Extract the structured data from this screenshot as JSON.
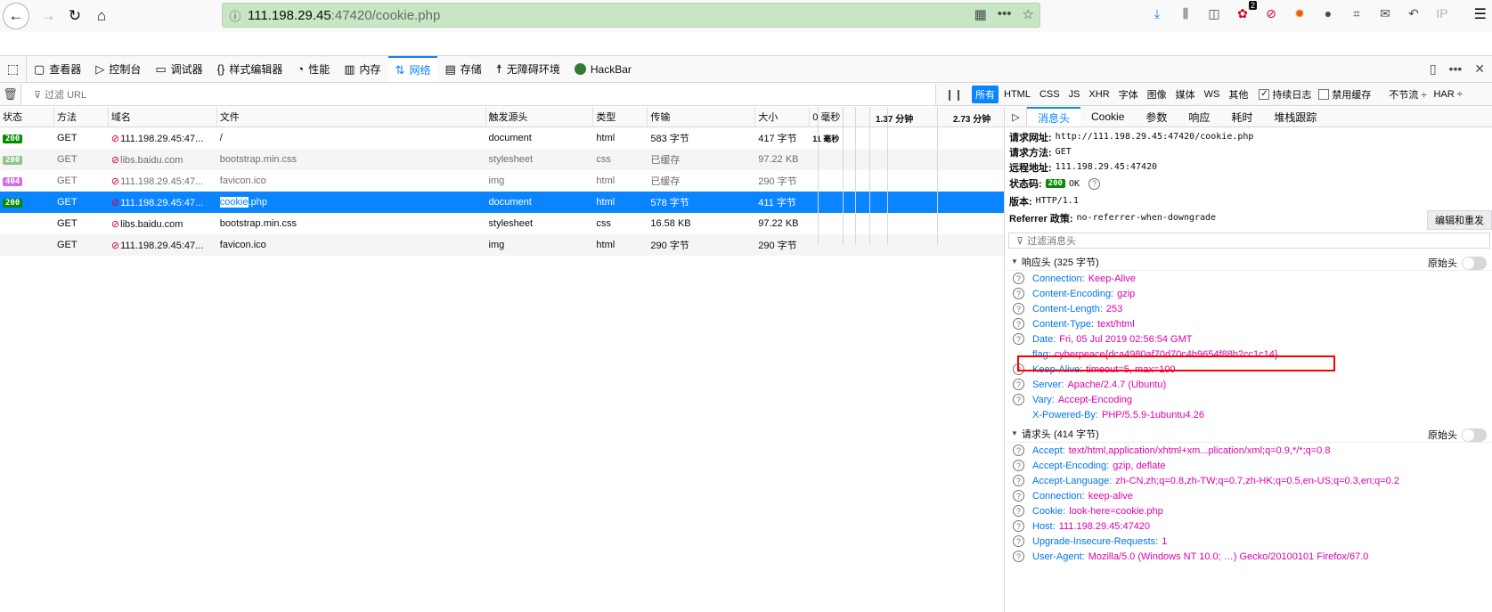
{
  "browser": {
    "url_host": "111.198.29.45",
    "url_rest": ":47420/cookie.php",
    "toolbar_badge": "2",
    "ip_ext": "IP"
  },
  "devtools": {
    "tabs": [
      {
        "label": "查看器",
        "icon": "inspector-icon"
      },
      {
        "label": "控制台",
        "icon": "console-icon"
      },
      {
        "label": "调试器",
        "icon": "debugger-icon"
      },
      {
        "label": "样式编辑器",
        "icon": "style-editor-icon"
      },
      {
        "label": "性能",
        "icon": "performance-icon"
      },
      {
        "label": "内存",
        "icon": "memory-icon"
      },
      {
        "label": "网络",
        "icon": "network-icon"
      },
      {
        "label": "存储",
        "icon": "storage-icon"
      },
      {
        "label": "无障碍环境",
        "icon": "accessibility-icon"
      },
      {
        "label": "HackBar",
        "icon": "hackbar-icon"
      }
    ]
  },
  "filter": {
    "placeholder": "过滤 URL",
    "types": [
      "所有",
      "HTML",
      "CSS",
      "JS",
      "XHR",
      "字体",
      "图像",
      "媒体",
      "WS",
      "其他"
    ],
    "persist_log": "持续日志",
    "disable_cache": "禁用缓存",
    "throttle": "不节流 ÷",
    "har": "HAR ÷"
  },
  "table": {
    "headers": [
      "状态",
      "方法",
      "域名",
      "文件",
      "触发源头",
      "类型",
      "传输",
      "大小",
      "0 毫秒"
    ],
    "timeline_labels": [
      "1.37 分钟",
      "2.73 分钟"
    ],
    "rows": [
      {
        "status": "200",
        "method": "GET",
        "domain": "111.198.29.45:47...",
        "file": "/",
        "cause": "document",
        "type": "html",
        "transferred": "583 字节",
        "size": "417 字节",
        "time": "11 毫秒"
      },
      {
        "status": "200",
        "method": "GET",
        "domain": "libs.baidu.com",
        "file": "bootstrap.min.css",
        "cause": "stylesheet",
        "type": "css",
        "transferred": "已缓存",
        "size": "97.22 KB",
        "time": ""
      },
      {
        "status": "404",
        "method": "GET",
        "domain": "111.198.29.45:47...",
        "file": "favicon.ico",
        "cause": "img",
        "type": "html",
        "transferred": "已缓存",
        "size": "290 字节",
        "time": ""
      },
      {
        "status": "200",
        "method": "GET",
        "domain": "111.198.29.45:47...",
        "file_hl": "cookie",
        "file": ".php",
        "cause": "document",
        "type": "html",
        "transferred": "578 字节",
        "size": "411 字节",
        "time": ""
      },
      {
        "status": "",
        "method": "GET",
        "domain": "libs.baidu.com",
        "file": "bootstrap.min.css",
        "cause": "stylesheet",
        "type": "css",
        "transferred": "16.58 KB",
        "size": "97.22 KB",
        "time": ""
      },
      {
        "status": "",
        "method": "GET",
        "domain": "111.198.29.45:47...",
        "file": "favicon.ico",
        "cause": "img",
        "type": "html",
        "transferred": "290 字节",
        "size": "290 字节",
        "time": ""
      }
    ]
  },
  "details": {
    "tabs": [
      "消息头",
      "Cookie",
      "参数",
      "响应",
      "耗时",
      "堆栈跟踪"
    ],
    "summary": {
      "url_label": "请求网址:",
      "url": "http://111.198.29.45:47420/cookie.php",
      "method_label": "请求方法:",
      "method": "GET",
      "remote_label": "远程地址:",
      "remote": "111.198.29.45:47420",
      "status_label": "状态码:",
      "status": "200",
      "status_text": "OK",
      "version_label": "版本:",
      "version": "HTTP/1.1",
      "referrer_label": "Referrer 政策:",
      "referrer": "no-referrer-when-downgrade"
    },
    "resend": "编辑和重发",
    "filter_placeholder": "过滤消息头",
    "raw_label": "原始头",
    "response_title": "响应头 (325 字节)",
    "response_headers": [
      {
        "name": "Connection:",
        "value": "Keep-Alive"
      },
      {
        "name": "Content-Encoding:",
        "value": "gzip"
      },
      {
        "name": "Content-Length:",
        "value": "253"
      },
      {
        "name": "Content-Type:",
        "value": "text/html"
      },
      {
        "name": "Date:",
        "value": "Fri, 05 Jul 2019 02:56:54 GMT"
      },
      {
        "name": "flag:",
        "value": "cyberpeace{dca4980af70d70c4b9654f88b2cc1c14}"
      },
      {
        "name": "Keep-Alive:",
        "value": "timeout=5, max=100"
      },
      {
        "name": "Server:",
        "value": "Apache/2.4.7 (Ubuntu)"
      },
      {
        "name": "Vary:",
        "value": "Accept-Encoding"
      },
      {
        "name": "X-Powered-By:",
        "value": "PHP/5.5.9-1ubuntu4.26"
      }
    ],
    "request_title": "请求头 (414 字节)",
    "request_headers": [
      {
        "name": "Accept:",
        "value": "text/html,application/xhtml+xm...plication/xml;q=0.9,*/*;q=0.8"
      },
      {
        "name": "Accept-Encoding:",
        "value": "gzip, deflate"
      },
      {
        "name": "Accept-Language:",
        "value": "zh-CN,zh;q=0.8,zh-TW;q=0.7,zh-HK;q=0.5,en-US;q=0.3,en;q=0.2"
      },
      {
        "name": "Connection:",
        "value": "keep-alive"
      },
      {
        "name": "Cookie:",
        "value": "look-here=cookie.php"
      },
      {
        "name": "Host:",
        "value": "111.198.29.45:47420"
      },
      {
        "name": "Upgrade-Insecure-Requests:",
        "value": "1"
      },
      {
        "name": "User-Agent:",
        "value": "Mozilla/5.0 (Windows NT 10.0; …) Gecko/20100101 Firefox/67.0"
      }
    ]
  }
}
